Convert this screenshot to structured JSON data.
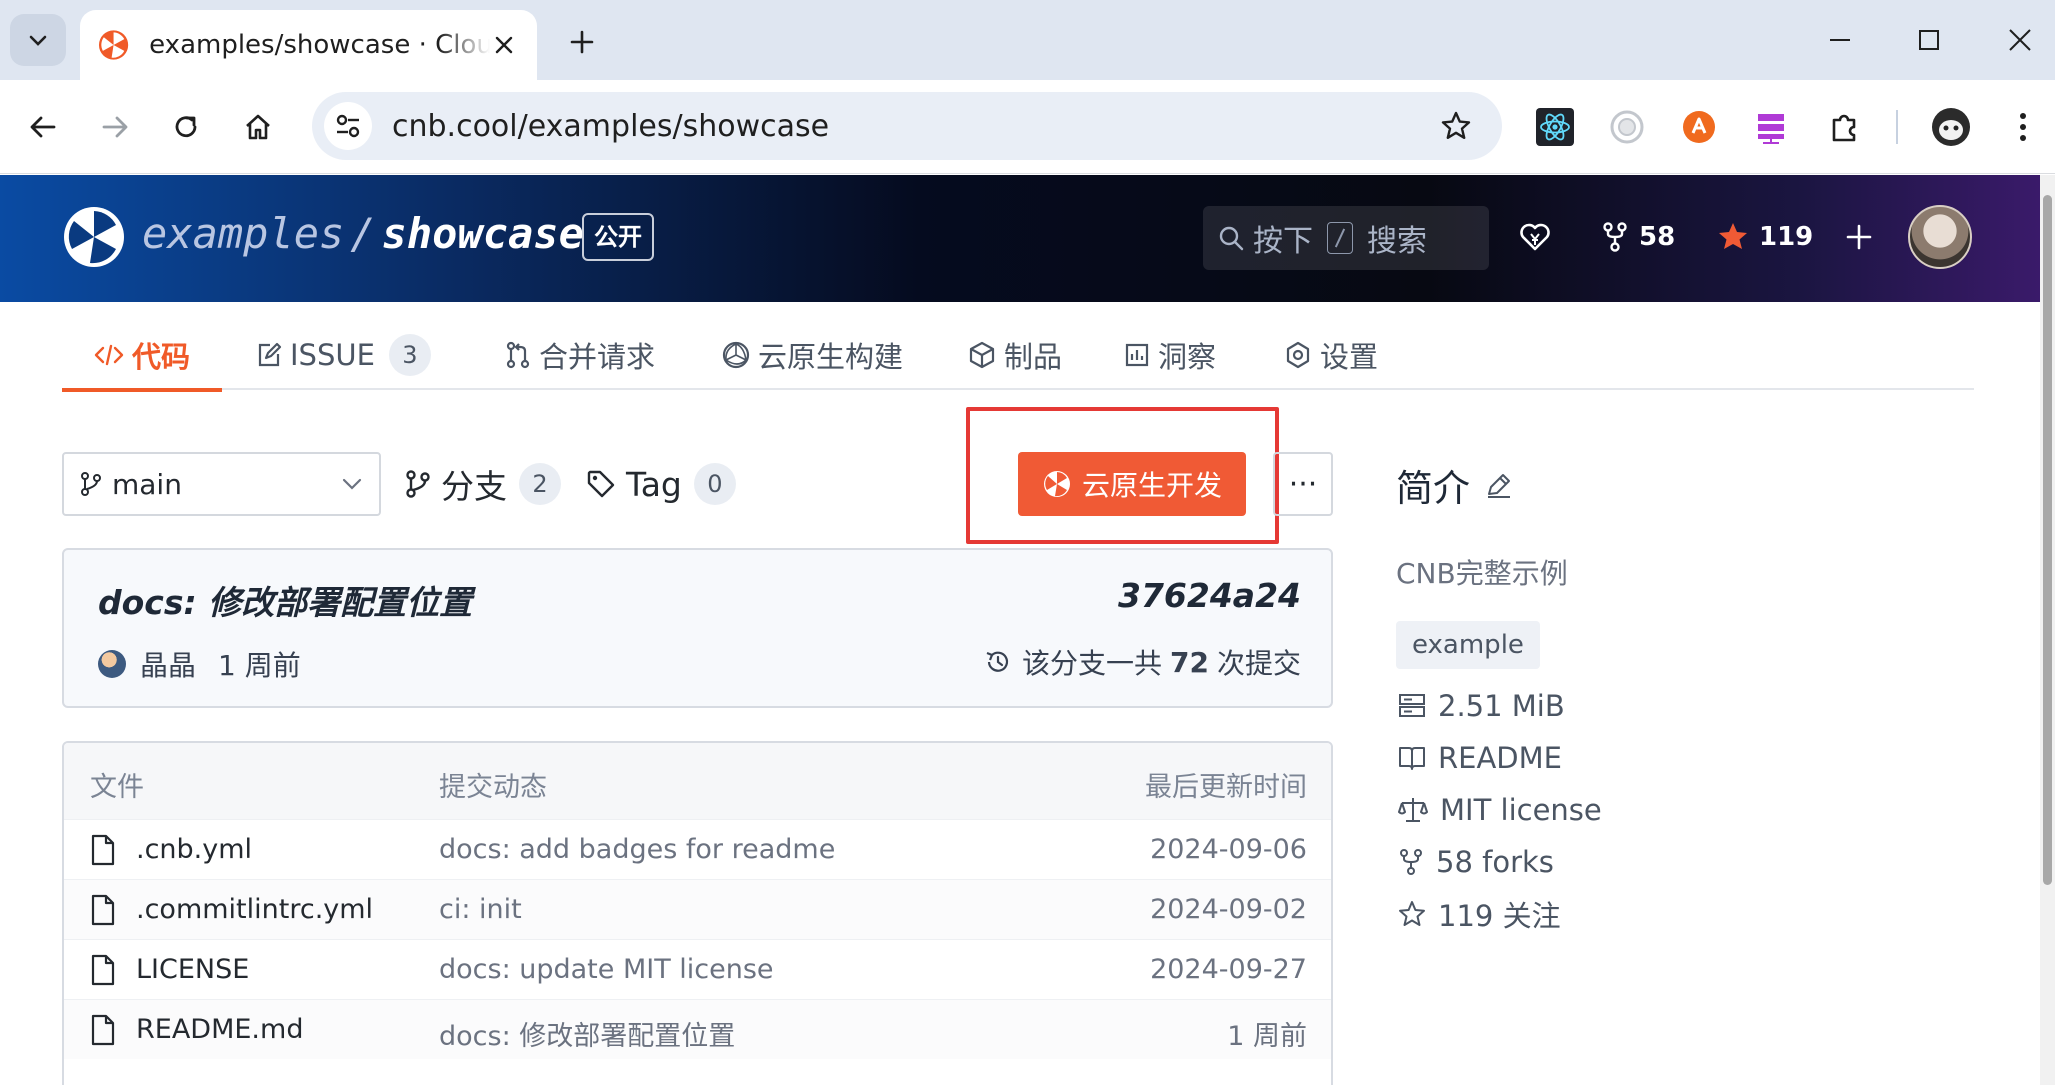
{
  "browser": {
    "tab_title": "examples/showcase · Cloud Native Build",
    "url": "cnb.cool/examples/showcase"
  },
  "repo": {
    "owner": "examples",
    "name": "showcase",
    "separator": "/",
    "visibility": "公开",
    "search_prefix": "按下",
    "search_suffix": "搜索",
    "forks": "58",
    "stars": "119"
  },
  "tabs": [
    {
      "label": "代码",
      "icon": "code-icon",
      "active": true
    },
    {
      "label": "ISSUE",
      "icon": "issue-icon",
      "count": "3"
    },
    {
      "label": "合并请求",
      "icon": "pull-request-icon"
    },
    {
      "label": "云原生构建",
      "icon": "build-icon"
    },
    {
      "label": "制品",
      "icon": "package-icon"
    },
    {
      "label": "洞察",
      "icon": "insights-icon"
    },
    {
      "label": "设置",
      "icon": "settings-icon"
    }
  ],
  "branch_bar": {
    "current_branch": "main",
    "branches_label": "分支",
    "branches_count": "2",
    "tags_label": "Tag",
    "tags_count": "0",
    "dev_button": "云原生开发",
    "more": "···"
  },
  "latest_commit": {
    "message": "docs: 修改部署配置位置",
    "hash": "37624a24",
    "author": "晶晶",
    "time": "1 周前",
    "total_prefix": "该分支一共",
    "total_count": "72",
    "total_suffix": "次提交"
  },
  "files": {
    "headers": {
      "name": "文件",
      "message": "提交动态",
      "updated": "最后更新时间"
    },
    "rows": [
      {
        "name": ".cnb.yml",
        "message": "docs: add badges for readme",
        "date": "2024-09-06"
      },
      {
        "name": ".commitlintrc.yml",
        "message": "ci: init",
        "date": "2024-09-02"
      },
      {
        "name": "LICENSE",
        "message": "docs: update MIT license",
        "date": "2024-09-27"
      },
      {
        "name": "README.md",
        "message": "docs: 修改部署配置位置",
        "date": "1 周前"
      }
    ]
  },
  "about": {
    "title": "简介",
    "description": "CNB完整示例",
    "topic": "example",
    "size": "2.51 MiB",
    "readme": "README",
    "license": "MIT license",
    "forks": "58 forks",
    "watchers": "119 关注"
  },
  "colors": {
    "accent": "#f05a28",
    "highlight_box": "#e53935",
    "header_bg_start": "#0a4ba3",
    "header_bg_end": "#3a1a6a"
  }
}
